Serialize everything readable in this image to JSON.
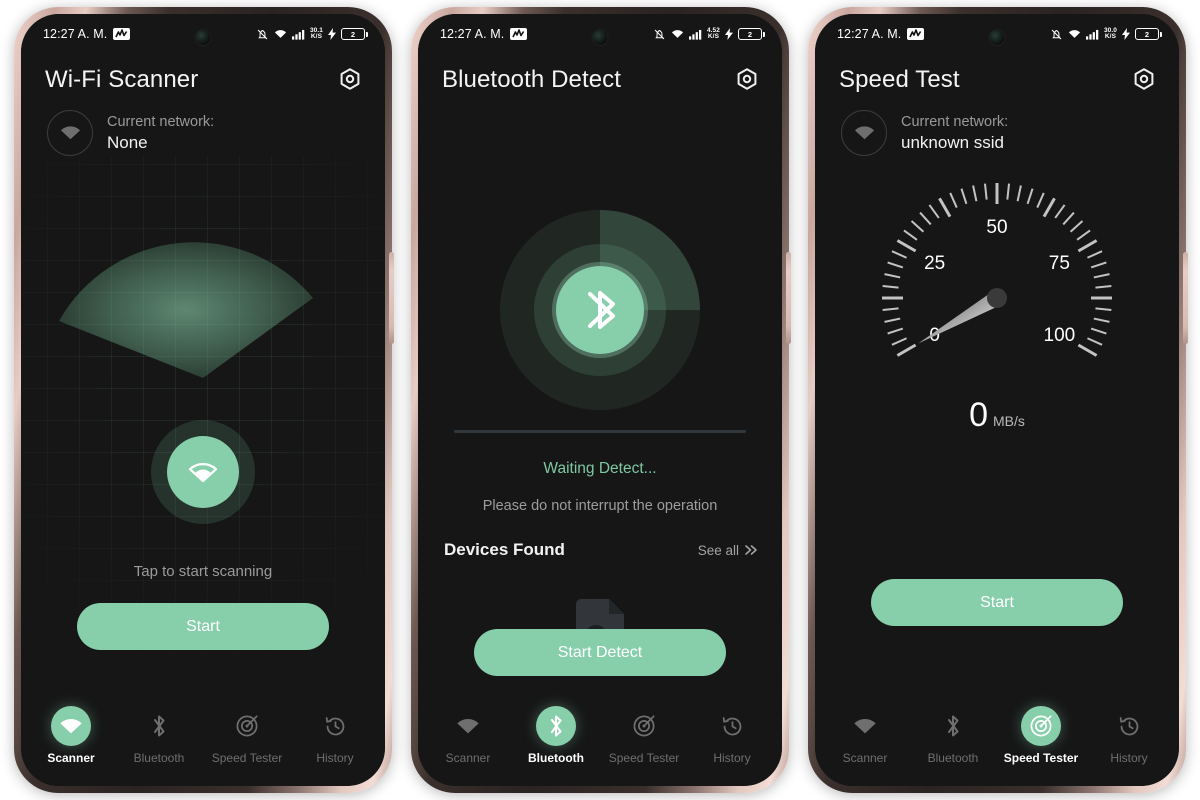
{
  "theme": {
    "accent": "#87ceab",
    "screen_bg": "#161616",
    "frame": "#d9bcb3",
    "text_primary": "#f2f2f2",
    "text_muted": "#9a9a9a"
  },
  "phones": [
    {
      "id": "wifi-scanner",
      "status_bar": {
        "time": "12:27 A. M.",
        "network_activity_icon": "activity-graph-icon",
        "mute_icon": "bell-muted-icon",
        "wifi_icon": "wifi-icon",
        "signal_icon": "cell-signal-icon",
        "data_rate": "30.1",
        "data_rate_unit": "K/S",
        "charging_icon": "charging-bolt-icon",
        "battery_level": "2"
      },
      "header": {
        "title": "Wi-Fi Scanner",
        "settings_icon": "gear-icon"
      },
      "network": {
        "icon": "wifi-icon",
        "label": "Current network:",
        "value": "None"
      },
      "radar": {
        "hub_icon": "wifi-icon",
        "sweep": "cone"
      },
      "hint": "Tap to start scanning",
      "cta": "Start",
      "nav_active": "Scanner"
    },
    {
      "id": "bluetooth-detect",
      "status_bar": {
        "time": "12:27 A. M.",
        "network_activity_icon": "activity-graph-icon",
        "mute_icon": "bell-muted-icon",
        "wifi_icon": "wifi-icon",
        "signal_icon": "cell-signal-icon",
        "data_rate": "4.52",
        "data_rate_unit": "K/S",
        "charging_icon": "charging-bolt-icon",
        "battery_level": "2"
      },
      "header": {
        "title": "Bluetooth Detect",
        "settings_icon": "gear-icon"
      },
      "radar": {
        "hub_icon": "bluetooth-icon",
        "sweep": "arc"
      },
      "status": "Waiting Detect...",
      "subtitle": "Please do not interrupt the operation",
      "devices_found_title": "Devices Found",
      "see_all": "See all",
      "see_all_icon": "double-chevron-right-icon",
      "empty_icon": "document-search-icon",
      "cta": "Start Detect",
      "nav_active": "Bluetooth"
    },
    {
      "id": "speed-test",
      "status_bar": {
        "time": "12:27 A. M.",
        "network_activity_icon": "activity-graph-icon",
        "mute_icon": "bell-muted-icon",
        "wifi_icon": "wifi-icon",
        "signal_icon": "cell-signal-icon",
        "data_rate": "30.0",
        "data_rate_unit": "K/S",
        "charging_icon": "charging-bolt-icon",
        "battery_level": "2"
      },
      "header": {
        "title": "Speed Test",
        "settings_icon": "gear-icon"
      },
      "network": {
        "icon": "wifi-icon",
        "label": "Current network:",
        "value": "unknown ssid"
      },
      "gauge": {
        "labels": [
          "0",
          "25",
          "50",
          "75",
          "100"
        ],
        "min": 0,
        "max": 100,
        "value": 0,
        "needle_icon": "gauge-needle"
      },
      "readout_value": "0",
      "readout_unit": "MB/s",
      "cta": "Start",
      "nav_active": "Speed Tester"
    }
  ],
  "nav": [
    {
      "label": "Scanner",
      "icon": "wifi-icon"
    },
    {
      "label": "Bluetooth",
      "icon": "bluetooth-icon"
    },
    {
      "label": "Speed Tester",
      "icon": "target-icon"
    },
    {
      "label": "History",
      "icon": "history-clock-icon"
    }
  ]
}
